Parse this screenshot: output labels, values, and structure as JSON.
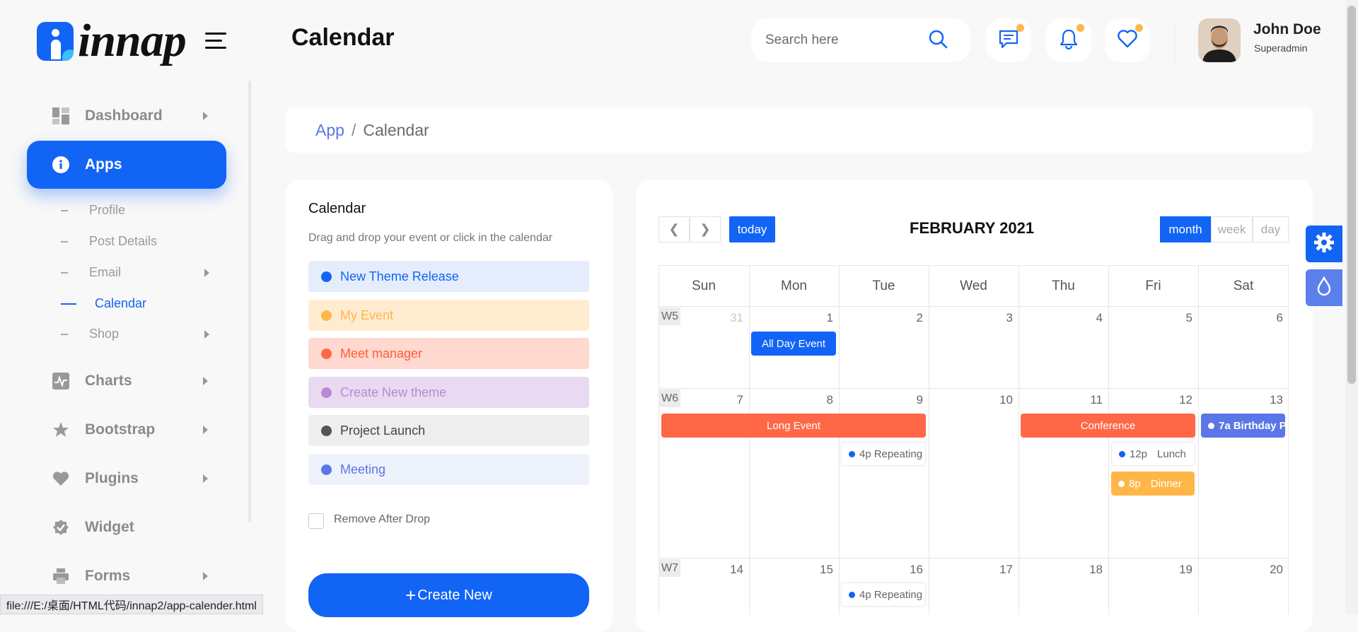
{
  "brand": {
    "name": "innap",
    "accent": "#1264f5"
  },
  "header": {
    "title": "Calendar",
    "search_placeholder": "Search here"
  },
  "user": {
    "name": "John Doe",
    "role": "Superadmin"
  },
  "sidebar": {
    "items": [
      {
        "label": "Dashboard",
        "icon": "dashboard-icon"
      },
      {
        "label": "Apps",
        "icon": "info-icon"
      },
      {
        "label": "Charts",
        "icon": "chart-icon"
      },
      {
        "label": "Bootstrap",
        "icon": "star-icon"
      },
      {
        "label": "Plugins",
        "icon": "heart-icon"
      },
      {
        "label": "Widget",
        "icon": "widget-icon"
      },
      {
        "label": "Forms",
        "icon": "printer-icon"
      }
    ],
    "subitems": [
      "Profile",
      "Post Details",
      "Email",
      "Calendar",
      "Shop"
    ]
  },
  "breadcrumb": {
    "root": "App",
    "sep": "/",
    "current": "Calendar"
  },
  "events_panel": {
    "title": "Calendar",
    "description": "Drag and drop your event or click in the calendar",
    "events": [
      {
        "label": "New Theme Release",
        "color": "#1264f5"
      },
      {
        "label": "My Event",
        "color": "#ffb648"
      },
      {
        "label": "Meet manager",
        "color": "#ff6847"
      },
      {
        "label": "Create New theme",
        "color": "#b58ad6"
      },
      {
        "label": "Project Launch",
        "color": "#555555"
      },
      {
        "label": "Meeting",
        "color": "#5b76e6"
      }
    ],
    "remove_label": "Remove After Drop",
    "create_label": "Create New"
  },
  "calendar": {
    "title": "FEBRUARY 2021",
    "today_label": "today",
    "views": [
      "month",
      "week",
      "day"
    ],
    "active_view": "month",
    "days_of_week": [
      "Sun",
      "Mon",
      "Tue",
      "Wed",
      "Thu",
      "Fri",
      "Sat"
    ],
    "weeks": [
      {
        "label": "W5",
        "days": [
          "31",
          "1",
          "2",
          "3",
          "4",
          "5",
          "6"
        ]
      },
      {
        "label": "W6",
        "days": [
          "7",
          "8",
          "9",
          "10",
          "11",
          "12",
          "13"
        ]
      },
      {
        "label": "W7",
        "days": [
          "14",
          "15",
          "16",
          "17",
          "18",
          "19",
          "20"
        ]
      }
    ],
    "events": {
      "all_day": "All Day Event",
      "long": "Long Event",
      "conference": "Conference",
      "birthday_time": "7a",
      "birthday": "Birthday Party",
      "repeating_time": "4p",
      "repeating": "Repeating Event",
      "lunch_time": "12p",
      "lunch": "Lunch",
      "dinner_time": "8p",
      "dinner": "Dinner"
    }
  },
  "status_url": "file:///E:/桌面/HTML代码/innap2/app-calender.html"
}
